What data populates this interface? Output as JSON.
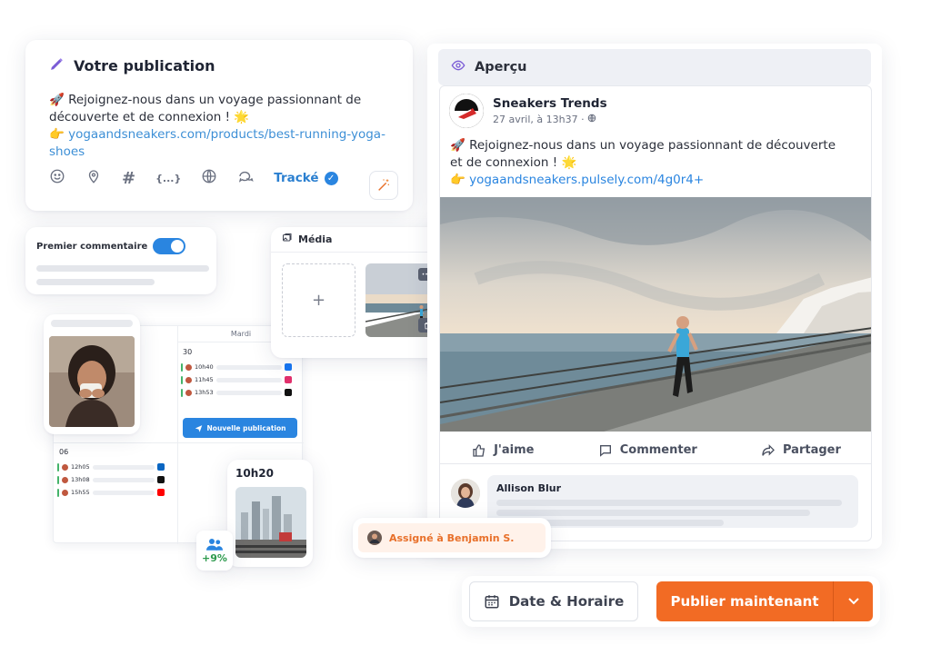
{
  "composer": {
    "title": "Votre publication",
    "text_line1": "🚀 Rejoignez-nous dans un voyage passionnant de",
    "text_line2": "découverte et de connexion ! 🌟",
    "link_prefix": "👉 ",
    "link": "yogaandsneakers.com/products/best-running-yoga-",
    "link2": "shoes",
    "tool_hashtag": "#",
    "tool_variables": "{...}",
    "tracked_label": "Tracké"
  },
  "first_comment": {
    "label": "Premier commentaire"
  },
  "media": {
    "title": "Média",
    "add_symbol": "+",
    "more_symbol": "•••"
  },
  "calendar": {
    "column_header": "Mardi",
    "day_top": "30",
    "day_bottom": "06",
    "top_slots": [
      {
        "time": "10h40",
        "network": "facebook",
        "color": "#1877f2"
      },
      {
        "time": "11h45",
        "network": "instagram",
        "color": "#e1306c"
      },
      {
        "time": "13h53",
        "network": "tiktok",
        "color": "#111111"
      }
    ],
    "bottom_slots": [
      {
        "time": "12h05",
        "network": "linkedin",
        "color": "#0a66c2"
      },
      {
        "time": "13h08",
        "network": "x",
        "color": "#111111"
      },
      {
        "time": "15h55",
        "network": "youtube",
        "color": "#ff0000"
      }
    ],
    "new_button": "Nouvelle publication"
  },
  "time_card": {
    "time": "10h20"
  },
  "stat": {
    "value": "+9%"
  },
  "assign": {
    "label": "Assigné à Benjamin S."
  },
  "preview": {
    "title": "Aperçu",
    "author": "Sneakers Trends",
    "date": "27 avril, à 13h37 · ",
    "text_line1": "🚀 Rejoignez-nous dans un voyage passionnant de découverte",
    "text_line2": "et de connexion ! 🌟",
    "link_prefix": "👉 ",
    "link": "yogaandsneakers.pulsely.com/4g0r4+",
    "like": "J'aime",
    "comment": "Commenter",
    "share": "Partager",
    "commenter_name": "Allison Blur"
  },
  "actions": {
    "date_label": "Date & Horaire",
    "publish_label": "Publier maintenant"
  },
  "colors": {
    "accent_blue": "#2a85e0",
    "accent_orange": "#f26b24",
    "success": "#2d9a4d"
  }
}
